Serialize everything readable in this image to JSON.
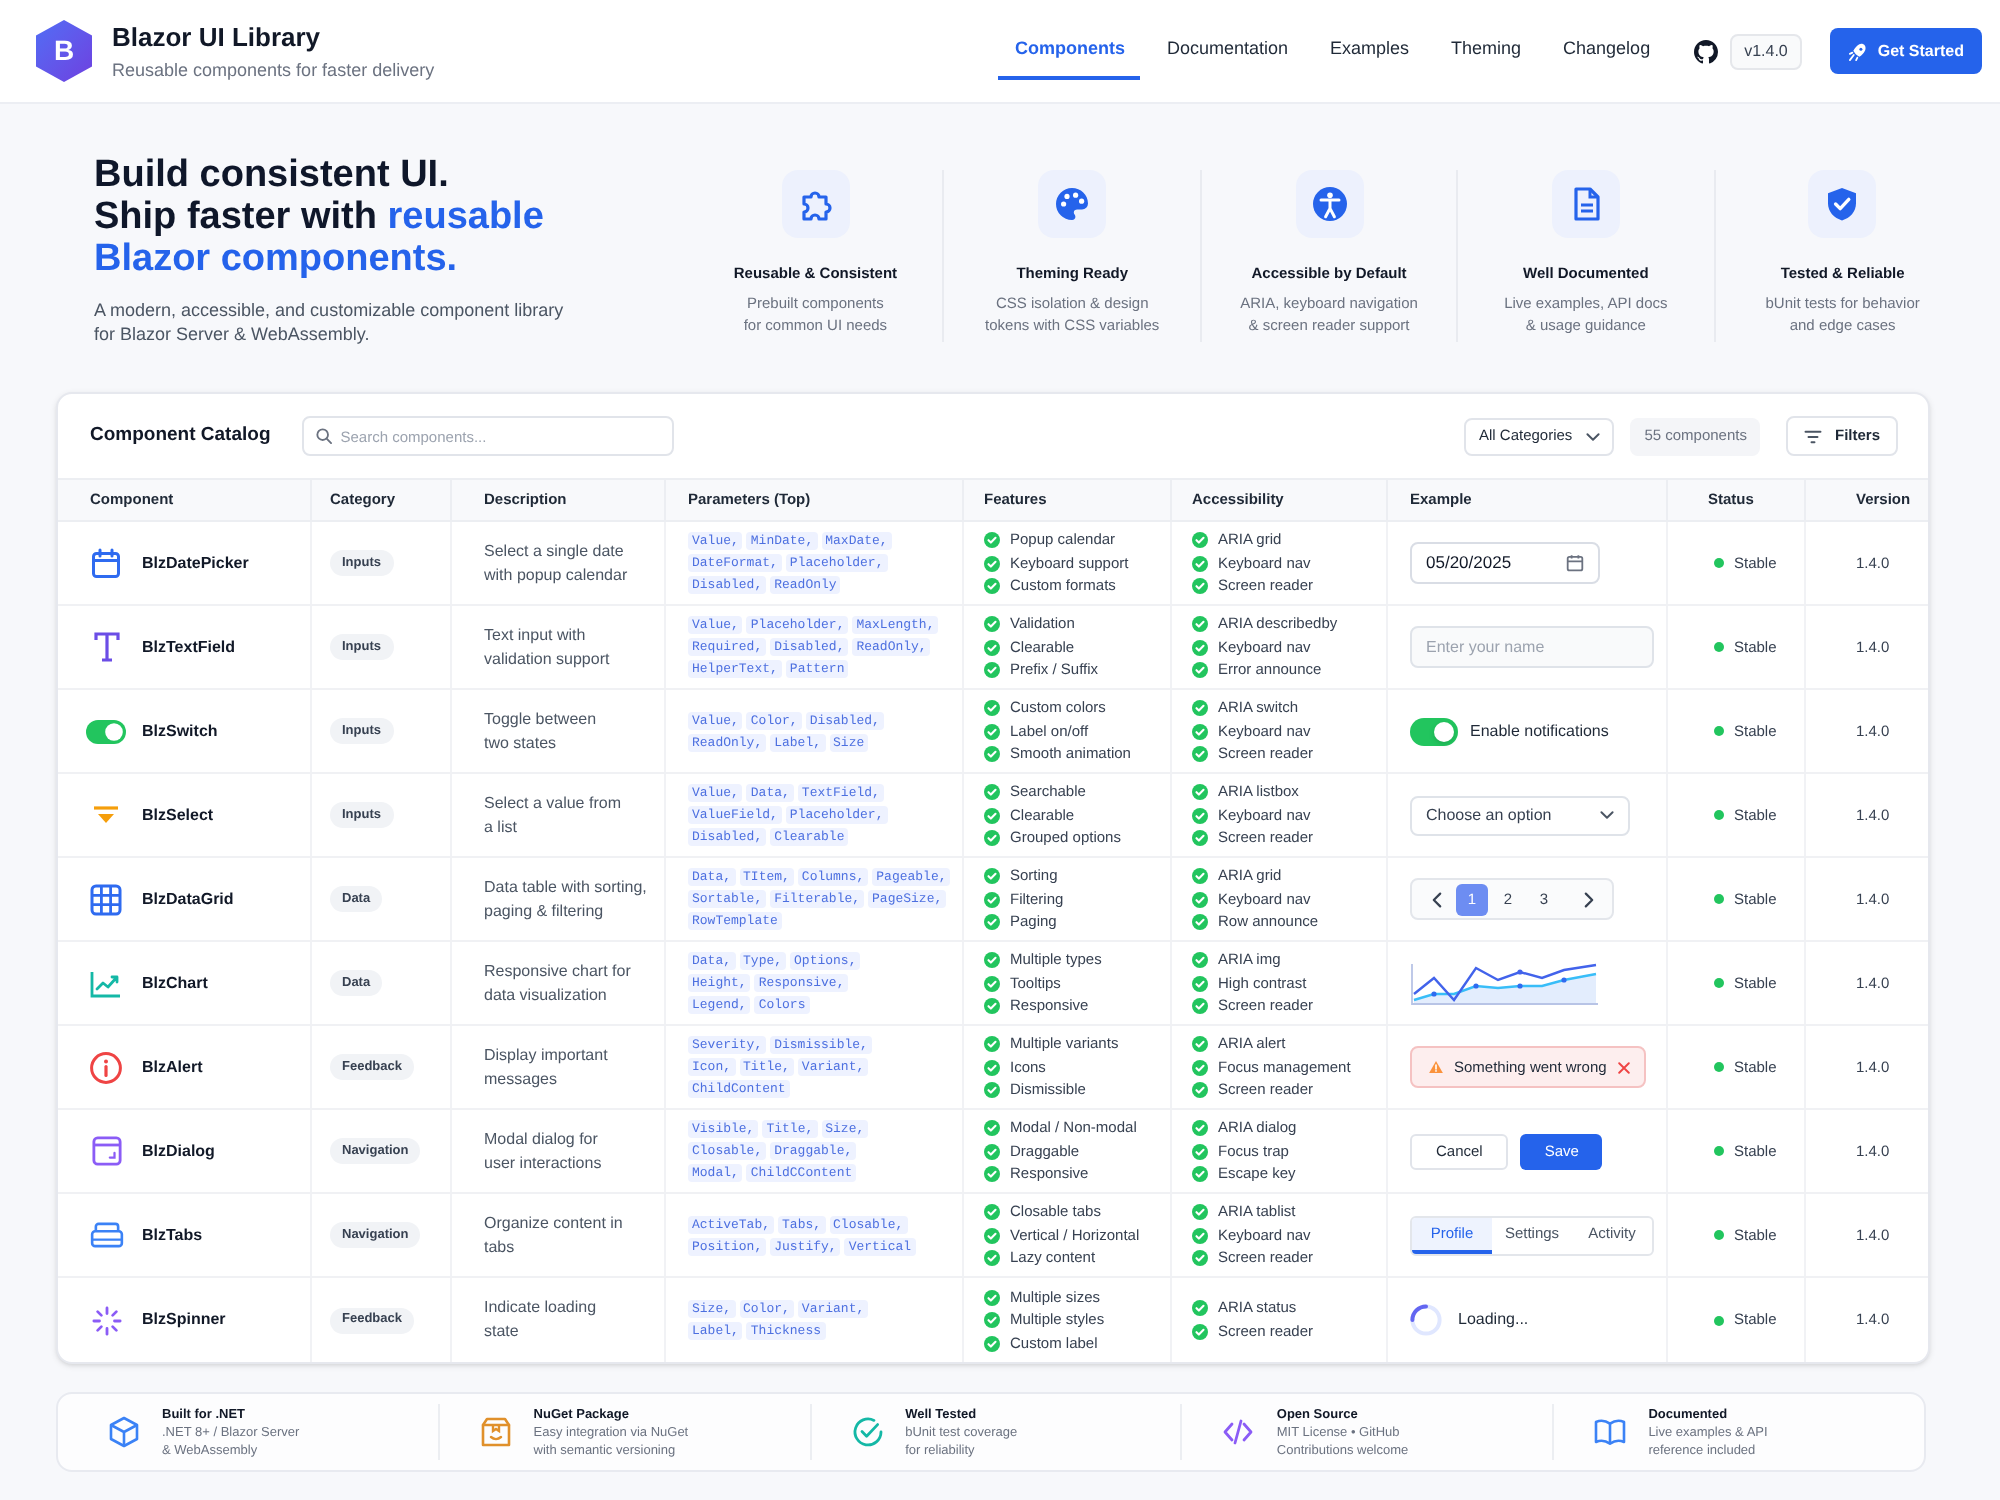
{
  "header": {
    "logo": "B",
    "title": "Blazor UI Library",
    "subtitle": "Reusable components for faster delivery",
    "nav": [
      {
        "label": "Components",
        "selected": true
      },
      {
        "label": "Documentation",
        "selected": false
      },
      {
        "label": "Examples",
        "selected": false
      },
      {
        "label": "Theming",
        "selected": false
      },
      {
        "label": "Changelog",
        "selected": false
      }
    ],
    "version": "v1.4.0",
    "cta": "Get Started"
  },
  "hero": {
    "heading": {
      "first_line": "Build consistent UI.",
      "lead": "Ship faster with",
      "accent": "reusable Blazor components."
    },
    "description_lines": [
      "A modern, accessible, and customizable component library",
      "for Blazor Server & WebAssembly."
    ],
    "features": [
      {
        "title": "Reusable & Consistent",
        "description_lines": [
          "Prebuilt components",
          "for common UI needs"
        ]
      },
      {
        "title": "Theming Ready",
        "description_lines": [
          "CSS isolation & design",
          "tokens with CSS variables"
        ]
      },
      {
        "title": "Accessible by Default",
        "description_lines": [
          "ARIA, keyboard navigation",
          "& screen reader support"
        ]
      },
      {
        "title": "Well Documented",
        "description_lines": [
          "Live examples, API docs",
          "& usage guidance"
        ]
      },
      {
        "title": "Tested & Reliable",
        "description_lines": [
          "bUnit tests for behavior",
          "and edge cases"
        ]
      }
    ]
  },
  "catalog": {
    "title": "Component Catalog",
    "search": {
      "placeholder": "Search components..."
    },
    "category_filter": "All Categories",
    "count": "55 components",
    "filters_button": "Filters",
    "columns": [
      "Component",
      "Category",
      "Description",
      "Parameters (Top)",
      "Features",
      "Accessibility",
      "Example",
      "Status",
      "Version"
    ],
    "rows": [
      {
        "kind": "datepicker",
        "name": "BlzDatePicker",
        "category": "Inputs",
        "description_lines": [
          "Select a single date",
          "with popup calendar"
        ],
        "parameters": [
          [
            "Value,",
            "MinDate,",
            "MaxDate,"
          ],
          [
            "DateFormat,",
            "Placeholder,"
          ],
          [
            "Disabled,",
            "ReadOnly"
          ]
        ],
        "features": [
          "Popup calendar",
          "Keyboard support",
          "Custom formats"
        ],
        "accessibility": [
          "ARIA grid",
          "Keyboard nav",
          "Screen reader"
        ],
        "example": {
          "value": "05/20/2025"
        },
        "status": "Stable",
        "version": "1.4.0"
      },
      {
        "kind": "textfield",
        "name": "BlzTextField",
        "category": "Inputs",
        "description_lines": [
          "Text input with",
          "validation support"
        ],
        "parameters": [
          [
            "Value,",
            "Placeholder,",
            "MaxLength,"
          ],
          [
            "Required,",
            "Disabled,",
            "ReadOnly,"
          ],
          [
            "HelperText,",
            "Pattern"
          ]
        ],
        "features": [
          "Validation",
          "Clearable",
          "Prefix / Suffix"
        ],
        "accessibility": [
          "ARIA describedby",
          "Keyboard nav",
          "Error announce"
        ],
        "example": {
          "placeholder": "Enter your name"
        },
        "status": "Stable",
        "version": "1.4.0"
      },
      {
        "kind": "switch",
        "name": "BlzSwitch",
        "category": "Inputs",
        "description_lines": [
          "Toggle between",
          "two states"
        ],
        "parameters": [
          [
            "Value,",
            "Color,",
            "Disabled,"
          ],
          [
            "ReadOnly,",
            "Label,",
            "Size"
          ]
        ],
        "features": [
          "Custom colors",
          "Label on/off",
          "Smooth animation"
        ],
        "accessibility": [
          "ARIA switch",
          "Keyboard nav",
          "Screen reader"
        ],
        "example": {
          "on": true,
          "label": "Enable notifications"
        },
        "status": "Stable",
        "version": "1.4.0"
      },
      {
        "kind": "select",
        "name": "BlzSelect",
        "category": "Inputs",
        "description_lines": [
          "Select a value from",
          "a list"
        ],
        "parameters": [
          [
            "Value,",
            "Data,",
            "TextField,"
          ],
          [
            "ValueField,",
            "Placeholder,"
          ],
          [
            "Disabled,",
            "Clearable"
          ]
        ],
        "features": [
          "Searchable",
          "Clearable",
          "Grouped options"
        ],
        "accessibility": [
          "ARIA listbox",
          "Keyboard nav",
          "Screen reader"
        ],
        "example": {
          "placeholder": "Choose an option"
        },
        "status": "Stable",
        "version": "1.4.0"
      },
      {
        "kind": "datagrid",
        "name": "BlzDataGrid",
        "category": "Data",
        "description_lines": [
          "Data table with sorting,",
          "paging & filtering"
        ],
        "parameters": [
          [
            "Data,",
            "TItem,",
            "Columns,",
            "Pageable,"
          ],
          [
            "Sortable,",
            "Filterable,",
            "PageSize,"
          ],
          [
            "RowTemplate"
          ]
        ],
        "features": [
          "Sorting",
          "Filtering",
          "Paging"
        ],
        "accessibility": [
          "ARIA grid",
          "Keyboard nav",
          "Row announce"
        ],
        "example": {
          "pages": [
            {
              "label": "1",
              "selected": true
            },
            {
              "label": "2",
              "selected": false
            },
            {
              "label": "3",
              "selected": false
            }
          ]
        },
        "status": "Stable",
        "version": "1.4.0"
      },
      {
        "kind": "chart",
        "name": "BlzChart",
        "category": "Data",
        "description_lines": [
          "Responsive chart for",
          "data visualization"
        ],
        "parameters": [
          [
            "Data,",
            "Type,",
            "Options,"
          ],
          [
            "Height,",
            "Responsive,"
          ],
          [
            "Legend,",
            "Colors"
          ]
        ],
        "features": [
          "Multiple types",
          "Tooltips",
          "Responsive"
        ],
        "accessibility": [
          "ARIA img",
          "High contrast",
          "Screen reader"
        ],
        "status": "Stable",
        "version": "1.4.0"
      },
      {
        "kind": "alert",
        "name": "BlzAlert",
        "category": "Feedback",
        "description_lines": [
          "Display important",
          "messages"
        ],
        "parameters": [
          [
            "Severity,",
            "Dismissible,"
          ],
          [
            "Icon,",
            "Title,",
            "Variant,"
          ],
          [
            "ChildContent"
          ]
        ],
        "features": [
          "Multiple variants",
          "Icons",
          "Dismissible"
        ],
        "accessibility": [
          "ARIA alert",
          "Focus management",
          "Screen reader"
        ],
        "example": {
          "message": "Something went wrong"
        },
        "status": "Stable",
        "version": "1.4.0"
      },
      {
        "kind": "dialog",
        "name": "BlzDialog",
        "category": "Navigation",
        "description_lines": [
          "Modal dialog for",
          "user interactions"
        ],
        "parameters": [
          [
            "Visible,",
            "Title,",
            "Size,"
          ],
          [
            "Closable,",
            "Draggable,"
          ],
          [
            "Modal,",
            "ChildCContent"
          ]
        ],
        "features": [
          "Modal / Non-modal",
          "Draggable",
          "Responsive"
        ],
        "accessibility": [
          "ARIA dialog",
          "Focus trap",
          "Escape key"
        ],
        "example": {
          "buttons": [
            "Cancel",
            "Save"
          ]
        },
        "status": "Stable",
        "version": "1.4.0"
      },
      {
        "kind": "tabs",
        "name": "BlzTabs",
        "category": "Navigation",
        "description_lines": [
          "Organize content in",
          "tabs"
        ],
        "parameters": [
          [
            "ActiveTab,",
            "Tabs,",
            "Closable,"
          ],
          [
            "Position,",
            "Justify,",
            "Vertical"
          ]
        ],
        "features": [
          "Closable tabs",
          "Vertical / Horizontal",
          "Lazy content"
        ],
        "accessibility": [
          "ARIA tablist",
          "Keyboard nav",
          "Screen reader"
        ],
        "example": {
          "tabs": [
            {
              "label": "Profile",
              "selected": true
            },
            {
              "label": "Settings",
              "selected": false
            },
            {
              "label": "Activity",
              "selected": false
            }
          ]
        },
        "status": "Stable",
        "version": "1.4.0"
      },
      {
        "kind": "spinner",
        "name": "BlzSpinner",
        "category": "Feedback",
        "description_lines": [
          "Indicate loading",
          "state"
        ],
        "parameters": [
          [
            "Size,",
            "Color,",
            "Variant,"
          ],
          [
            "Label,",
            "Thickness"
          ]
        ],
        "features": [
          "Multiple sizes",
          "Multiple styles",
          "Custom label"
        ],
        "accessibility": [
          "ARIA status",
          "Screen reader"
        ],
        "example": {
          "label": "Loading..."
        },
        "status": "Stable",
        "version": "1.4.0"
      }
    ]
  },
  "footer_features": [
    {
      "title": "Built for .NET",
      "description_lines": [
        ".NET 8+ / Blazor Server",
        "& WebAssembly"
      ]
    },
    {
      "title": "NuGet Package",
      "description_lines": [
        "Easy integration via NuGet",
        "with semantic versioning"
      ]
    },
    {
      "title": "Well Tested",
      "description_lines": [
        "bUnit test coverage",
        "for reliability"
      ]
    },
    {
      "title": "Open Source",
      "description_lines": [
        "MIT License • GitHub",
        "Contributions welcome"
      ]
    },
    {
      "title": "Documented",
      "description_lines": [
        "Live examples & API",
        "reference included"
      ]
    }
  ]
}
